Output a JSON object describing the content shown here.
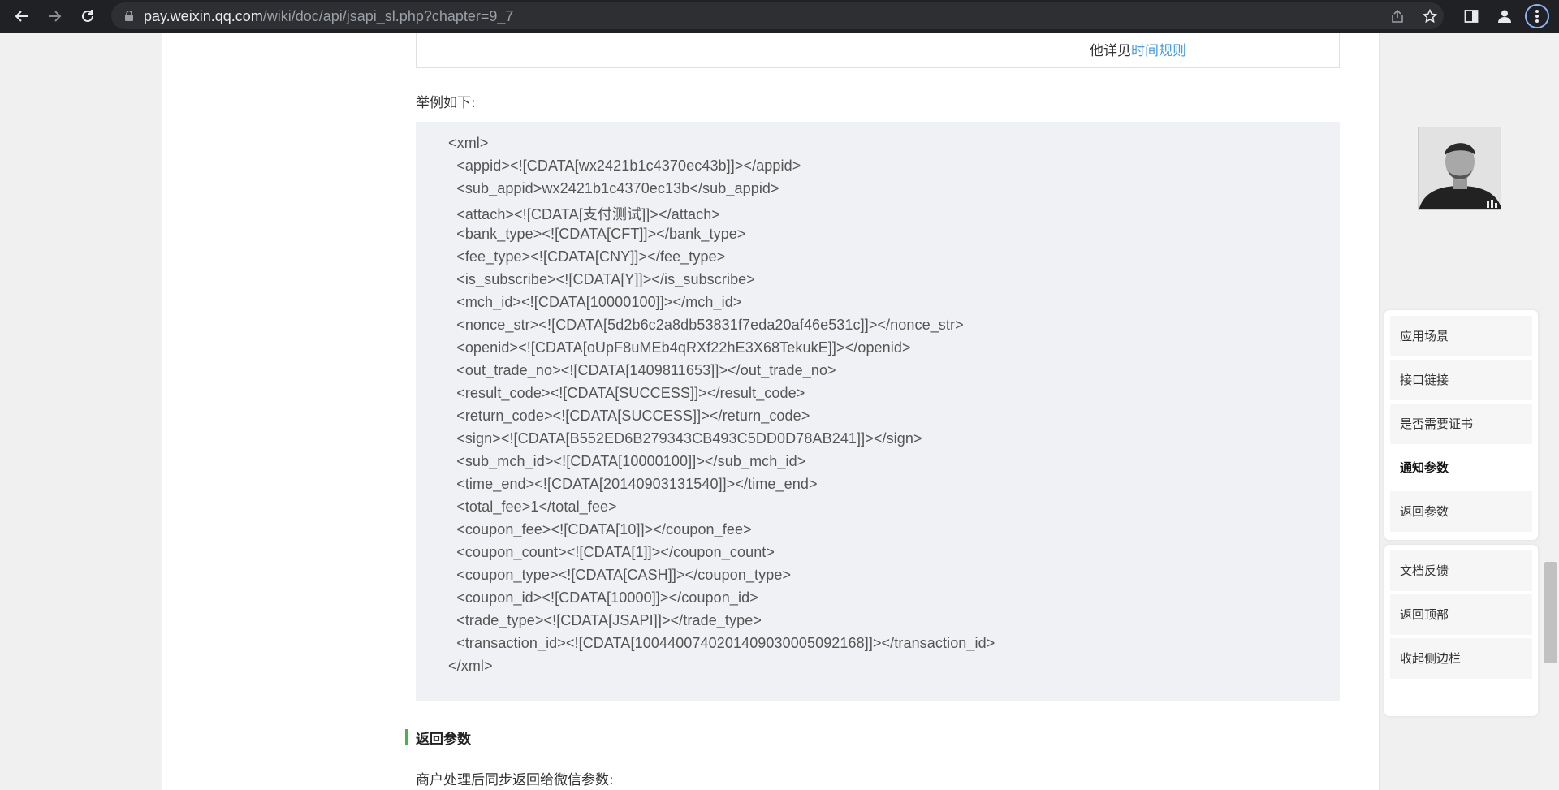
{
  "browser": {
    "url_host": "pay.weixin.qq.com",
    "url_path": "/wiki/doc/api/jsapi_sl.php?chapter=9_7"
  },
  "content": {
    "table_tail_text": "他详见",
    "table_tail_link": "时间规则",
    "example_label": "举例如下:",
    "code_lines": [
      "<xml>",
      "  <appid><![CDATA[wx2421b1c4370ec43b]]></appid>",
      "  <sub_appid>wx2421b1c4370ec13b</sub_appid>",
      "  <attach><![CDATA[支付测试]]></attach>",
      "  <bank_type><![CDATA[CFT]]></bank_type>",
      "  <fee_type><![CDATA[CNY]]></fee_type>",
      "  <is_subscribe><![CDATA[Y]]></is_subscribe>",
      "  <mch_id><![CDATA[10000100]]></mch_id>",
      "  <nonce_str><![CDATA[5d2b6c2a8db53831f7eda20af46e531c]]></nonce_str>",
      "  <openid><![CDATA[oUpF8uMEb4qRXf22hE3X68TekukE]]></openid>",
      "  <out_trade_no><![CDATA[1409811653]]></out_trade_no>",
      "  <result_code><![CDATA[SUCCESS]]></result_code>",
      "  <return_code><![CDATA[SUCCESS]]></return_code>",
      "  <sign><![CDATA[B552ED6B279343CB493C5DD0D78AB241]]></sign>",
      "  <sub_mch_id><![CDATA[10000100]]></sub_mch_id>",
      "  <time_end><![CDATA[20140903131540]]></time_end>",
      "  <total_fee>1</total_fee>",
      "  <coupon_fee><![CDATA[10]]></coupon_fee>",
      "  <coupon_count><![CDATA[1]]></coupon_count>",
      "  <coupon_type><![CDATA[CASH]]></coupon_type>",
      "  <coupon_id><![CDATA[10000]]></coupon_id>",
      "  <trade_type><![CDATA[JSAPI]]></trade_type>",
      "  <transaction_id><![CDATA[1004400740201409030005092168]]></transaction_id>",
      "</xml>"
    ],
    "section_title": "返回参数",
    "section_desc": "商户处理后同步返回给微信参数:"
  },
  "sidebar": {
    "nav_items": [
      "应用场景",
      "接口链接",
      "是否需要证书",
      "通知参数",
      "返回参数"
    ],
    "active_index": 3,
    "tool_items": [
      "文档反馈",
      "返回顶部",
      "收起侧边栏"
    ]
  },
  "colors": {
    "chrome_bg": "#202124",
    "link": "#459ae9",
    "heading_bar": "#44b549",
    "code_bg": "#f0f1f4"
  }
}
